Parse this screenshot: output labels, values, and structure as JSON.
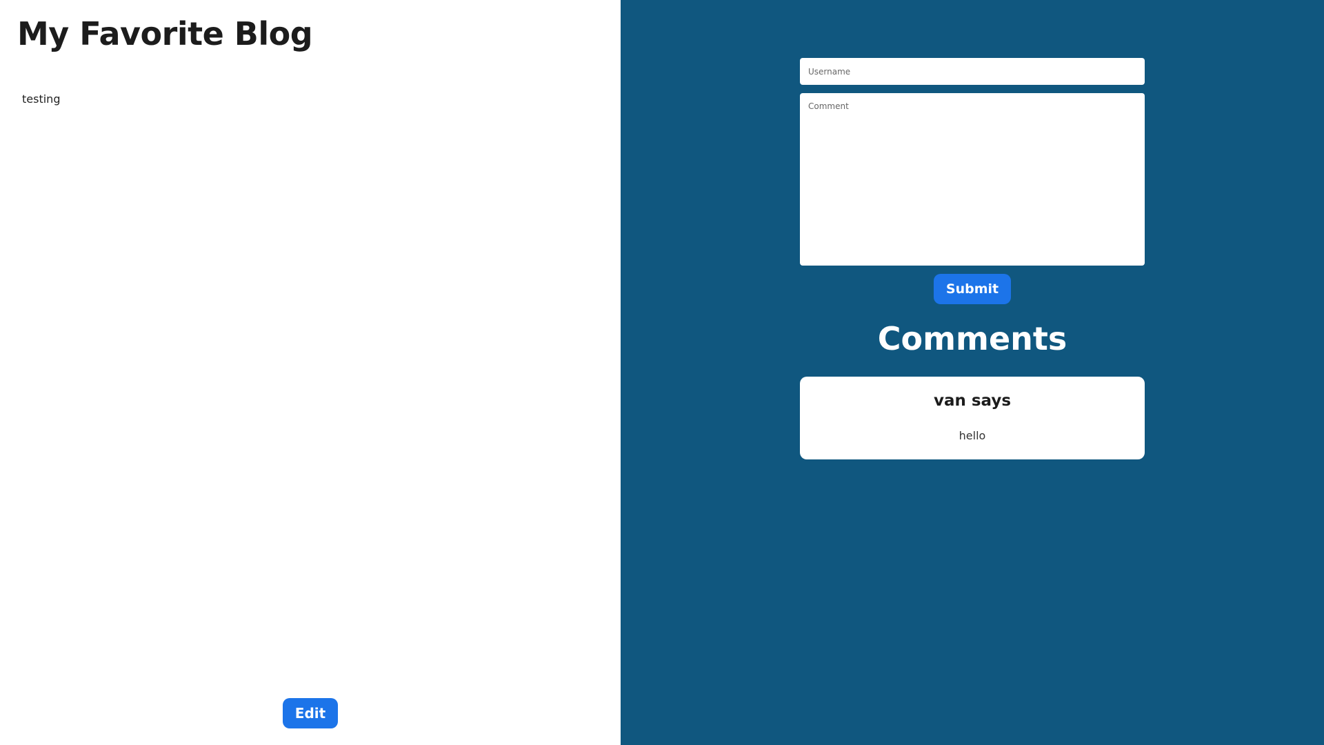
{
  "post": {
    "title": "My Favorite Blog",
    "body": "testing",
    "edit_label": "Edit"
  },
  "comment_form": {
    "username_placeholder": "Username",
    "comment_placeholder": "Comment",
    "submit_label": "Submit"
  },
  "comments": {
    "heading": "Comments",
    "items": [
      {
        "author_line": "van says",
        "text": "hello"
      }
    ]
  },
  "colors": {
    "left_background": "#ffffff",
    "right_background": "#10577f",
    "button": "#1c74e9"
  }
}
